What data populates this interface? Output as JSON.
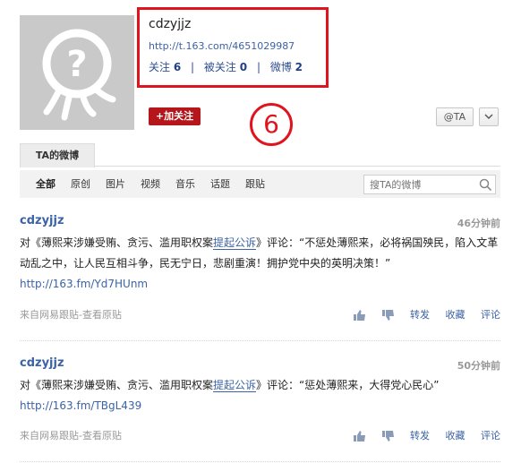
{
  "profile": {
    "username": "cdzyjjz",
    "url": "http://t.163.com/4651029987",
    "following_label": "关注",
    "following_count": "6",
    "followers_label": "被关注",
    "followers_count": "0",
    "posts_label": "微博",
    "posts_count": "2",
    "separator": "|"
  },
  "actions": {
    "follow_label": "+加关注",
    "at_label": "@TA",
    "more_label": "∨"
  },
  "annotation": {
    "step_number": "6"
  },
  "tabs": {
    "active_label": "TA的微博"
  },
  "filters": {
    "items": [
      "全部",
      "原创",
      "图片",
      "视频",
      "音乐",
      "话题",
      "跟贴"
    ],
    "search_placeholder": "搜TA的微博"
  },
  "posts": [
    {
      "author": "cdzyjjz",
      "time": "46分钟前",
      "text_before": "对《薄熙来涉嫌受贿、贪污、滥用职权案",
      "link_text": "提起公诉",
      "text_after": "》评论：“不惩处薄熙来，必将祸国殃民，陷入文革动乱之中，让人民互相斗争，民无宁日，悲剧重演！拥护党中央的英明决策！”",
      "url": "http://163.fm/Yd7HUnm",
      "source": "来自网易跟贴-查看原贴",
      "repost": "转发",
      "favorite": "收藏",
      "comment": "评论"
    },
    {
      "author": "cdzyjjz",
      "time": "50分钟前",
      "text_before": "对《薄熙来涉嫌受贿、贪污、滥用职权案",
      "link_text": "提起公诉",
      "text_after": "》评论：“惩处薄熙来，大得党心民心”",
      "url": "http://163.fm/TBgL439",
      "source": "来自网易跟贴-查看原贴",
      "repost": "转发",
      "favorite": "收藏",
      "comment": "评论"
    }
  ],
  "colors": {
    "highlight": "#e0141e",
    "follow_button": "#b5161b",
    "link": "#3b63a6"
  }
}
